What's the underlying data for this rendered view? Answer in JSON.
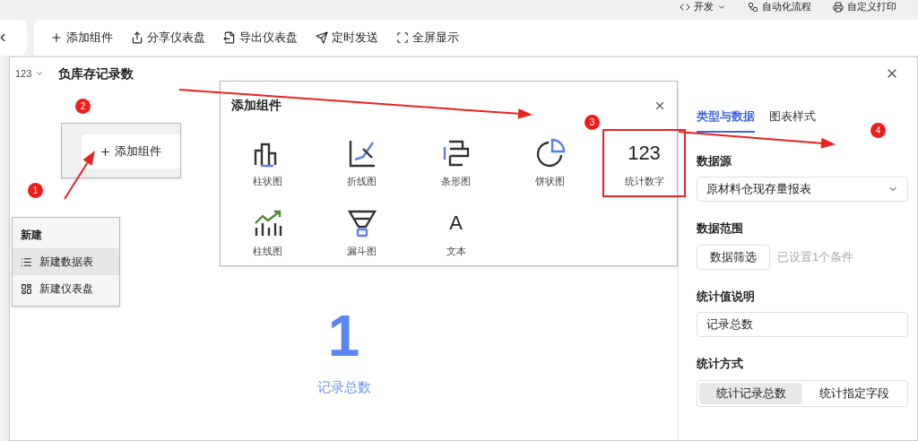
{
  "top_bar": {
    "items": [
      {
        "label": "开发",
        "kind": "dev"
      },
      {
        "label": "自动化流程",
        "kind": "flow"
      },
      {
        "label": "自定义打印",
        "kind": "print"
      }
    ]
  },
  "toolbar": {
    "buttons": [
      {
        "label": "添加组件",
        "kind": "add"
      },
      {
        "label": "分享仪表盘",
        "kind": "share"
      },
      {
        "label": "导出仪表盘",
        "kind": "export"
      },
      {
        "label": "定时发送",
        "kind": "send"
      },
      {
        "label": "全屏显示",
        "kind": "fullscreen"
      }
    ]
  },
  "modal": {
    "type_selector": "123",
    "title": "负库存记录数",
    "metric": {
      "value": "1",
      "label": "记录总数"
    }
  },
  "side_panel": {
    "tabs": [
      {
        "label": "类型与数据",
        "selected": true
      },
      {
        "label": "图表样式",
        "selected": false
      }
    ],
    "data_source": {
      "label": "数据源",
      "value": "原材料仓现存量报表"
    },
    "data_range": {
      "label": "数据范围",
      "button": "数据筛选",
      "note": "已设置1个条件"
    },
    "value_description": {
      "label": "统计值说明",
      "value": "记录总数"
    },
    "method": {
      "label": "统计方式",
      "options": [
        {
          "label": "统计记录总数",
          "selected": true
        },
        {
          "label": "统计指定字段",
          "selected": false
        }
      ]
    }
  },
  "annotations": {
    "badges": [
      "1",
      "2",
      "3",
      "4"
    ],
    "inset_button": "添加组件",
    "new_menu": {
      "title": "新建",
      "items": [
        {
          "label": "新建数据表",
          "kind": "table",
          "selected": true
        },
        {
          "label": "新建仪表盘",
          "kind": "dashboard",
          "selected": false
        }
      ]
    },
    "add_component_dialog": {
      "title": "添加组件",
      "items": [
        {
          "label": "柱状图",
          "kind": "bar",
          "highlighted": false
        },
        {
          "label": "折线图",
          "kind": "line",
          "highlighted": false
        },
        {
          "label": "条形图",
          "kind": "hbar",
          "highlighted": false
        },
        {
          "label": "饼状图",
          "kind": "pie",
          "highlighted": false
        },
        {
          "label": "统计数字",
          "kind": "number",
          "glyph": "123",
          "highlighted": true
        },
        {
          "label": "柱线图",
          "kind": "combo",
          "highlighted": false
        },
        {
          "label": "漏斗图",
          "kind": "funnel",
          "highlighted": false
        },
        {
          "label": "文本",
          "kind": "text",
          "glyph": "A",
          "highlighted": false
        }
      ]
    }
  }
}
